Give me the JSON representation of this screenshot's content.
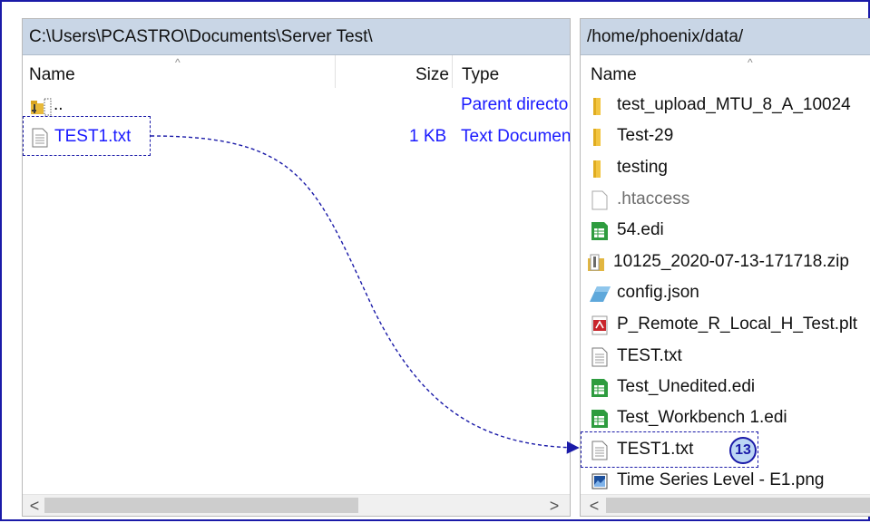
{
  "left_pane": {
    "path": "C:\\Users\\PCASTRO\\Documents\\Server Test\\",
    "headers": {
      "name": "Name",
      "size": "Size",
      "type": "Type"
    },
    "rows": [
      {
        "name": "..",
        "size": "",
        "type": "Parent directo",
        "icon": "parent-folder-icon"
      },
      {
        "name": "TEST1.txt",
        "size": "1 KB",
        "type": "Text Documen",
        "icon": "text-file-icon"
      }
    ]
  },
  "right_pane": {
    "path": "/home/phoenix/data/",
    "headers": {
      "name": "Name"
    },
    "rows": [
      {
        "name": "test_upload_MTU_8_A_10024",
        "icon": "folder-icon"
      },
      {
        "name": "Test-29",
        "icon": "folder-icon"
      },
      {
        "name": "testing",
        "icon": "folder-icon"
      },
      {
        "name": ".htaccess",
        "icon": "blank-file-icon"
      },
      {
        "name": "54.edi",
        "icon": "edi-file-icon"
      },
      {
        "name": "10125_2020-07-13-171718.zip",
        "icon": "zip-file-icon"
      },
      {
        "name": "config.json",
        "icon": "json-file-icon"
      },
      {
        "name": "P_Remote_R_Local_H_Test.plt",
        "icon": "pdf-file-icon"
      },
      {
        "name": "TEST.txt",
        "icon": "text-file-icon"
      },
      {
        "name": "Test_Unedited.edi",
        "icon": "edi-file-icon"
      },
      {
        "name": "Test_Workbench 1.edi",
        "icon": "edi-file-icon"
      },
      {
        "name": "TEST1.txt",
        "icon": "text-file-icon"
      },
      {
        "name": "Time Series Level - E1.png",
        "icon": "image-file-icon"
      }
    ]
  },
  "annotation": {
    "step_number": "13"
  },
  "scrollbars": {
    "left_arrow": "<",
    "right_arrow": ">"
  },
  "colors": {
    "accent": "#1a1aa8",
    "path_bar": "#c9d6e6",
    "link": "#1a1aff",
    "badge_fill": "#bcd6f4"
  }
}
